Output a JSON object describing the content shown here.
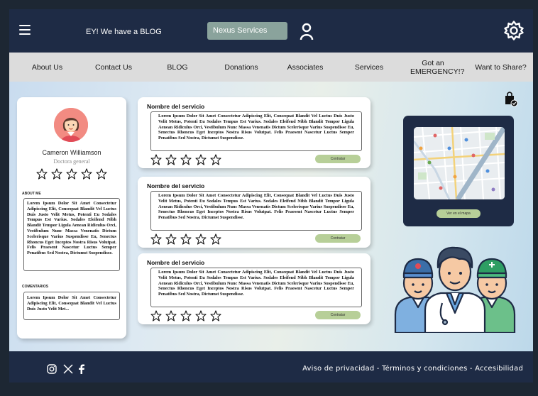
{
  "header": {
    "title": "EY! We have a BLOG",
    "services_button": "Nexus Services",
    "menu_icon": "hamburger-icon",
    "user_icon": "user-icon",
    "settings_icon": "gear-icon"
  },
  "nav": {
    "items": [
      {
        "label": "About Us"
      },
      {
        "label": "Contact Us"
      },
      {
        "label": "BLOG"
      },
      {
        "label": "Donations"
      },
      {
        "label": "Associates"
      },
      {
        "label": "Services"
      },
      {
        "label": "Got an EMERGENCY!?"
      },
      {
        "label": "Want to Share?"
      }
    ]
  },
  "profile": {
    "name": "Cameron Williamson",
    "role": "Doctora general",
    "rating": 0,
    "about_label": "ABOUT ME",
    "about_text": "Lorem Ipsum Dolor Sit Amet Consectetur Adipiscing Elit, Consequat Blandit Vel Luctus Duis Justo Velit Metus, Potenti Eu Sodales Tempus Est Varius. Sodales Eleifend Nibh Blandit Tempor Ligula Aenean Ridiculus Orci, Vestibulum Nunc Massa Venenatis Dictum Scelerisque Varius Suspendisse Eu, Senectus Rhoncus Eget Inceptos Nostra Risus Volutpat. Felis Praesent Nascetur Luctus Semper Penatibus Sed Nostra, Dictumst Suspendisse.",
    "comments_label": "COMENTARIOS",
    "comments_text": "Lorem Ipsum Dolor Sit Amet Consectetur Adipiscing Elit, Consequat Blandit Vel Luctus Duis Justo Velit Met..."
  },
  "services": [
    {
      "title": "Nombre del servicio",
      "description": "Lorem Ipsum Dolor Sit Amet Consectetur Adipiscing Elit, Consequat Blandit Vel Luctus Duis Justo Velit Metus, Potenti Eu Sodales Tempus Est Varius. Sodales Eleifend Nibh Blandit Tempor Ligula Aenean Ridiculus Orci, Vestibulum Nunc Massa Venenatis Dictum Scelerisque Varius Suspendisse Eu, Senectus Rhoncus Eget Inceptos Nostra Risus Volutpat. Felis Praesent Nascetur Luctus Semper Penatibus Sed Nostra, Dictumst Suspendisse.",
      "button": "Contratar",
      "rating": 0
    },
    {
      "title": "Nombre del servicio",
      "description": "Lorem Ipsum Dolor Sit Amet Consectetur Adipiscing Elit, Consequat Blandit Vel Luctus Duis Justo Velit Metus, Potenti Eu Sodales Tempus Est Varius. Sodales Eleifend Nibh Blandit Tempor Ligula Aenean Ridiculus Orci, Vestibulum Nunc Massa Venenatis Dictum Scelerisque Varius Suspendisse Eu, Senectus Rhoncus Eget Inceptos Nostra Risus Volutpat. Felis Praesent Nascetur Luctus Semper Penatibus Sed Nostra, Dictumst Suspendisse.",
      "button": "Contratar",
      "rating": 0
    },
    {
      "title": "Nombre del servicio",
      "description": "Lorem Ipsum Dolor Sit Amet Consectetur Adipiscing Elit, Consequat Blandit Vel Luctus Duis Justo Velit Metus, Potenti Eu Sodales Tempus Est Varius. Sodales Eleifend Nibh Blandit Tempor Ligula Aenean Ridiculus Orci, Vestibulum Nunc Massa Venenatis Dictum Scelerisque Varius Suspendisse Eu, Senectus Rhoncus Eget Inceptos Nostra Risus Volutpat. Felis Praesent Nascetur Luctus Semper Penatibus Sed Nostra, Dictumst Suspendisse.",
      "button": "Contratar",
      "rating": 0
    }
  ],
  "map": {
    "button": "Ver en el mapa"
  },
  "footer": {
    "links": "Aviso de privacidad - Términos y condiciones - Accesibilidad",
    "social_icons": [
      "instagram-icon",
      "x-icon",
      "facebook-icon"
    ]
  },
  "colors": {
    "navy": "#1e2b45",
    "nav_bg": "#dcdcdc",
    "accent_green": "#b7cf98",
    "services_button": "#8aa39c"
  }
}
